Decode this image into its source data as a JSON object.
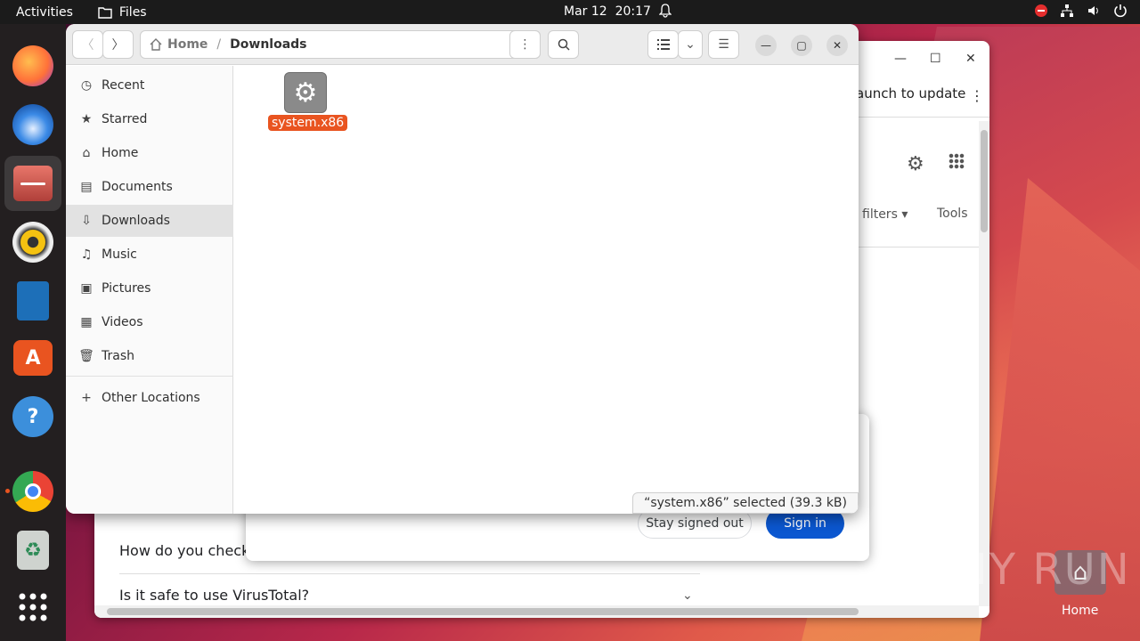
{
  "topbar": {
    "activities": "Activities",
    "app_name": "Files",
    "date": "Mar 12",
    "time": "20:17"
  },
  "browser": {
    "launch_text": "aunch to update",
    "filters_label": "filters",
    "tools_label": "Tools",
    "faq": [
      "How do you check i",
      "Is it safe to use VirusTotal?"
    ]
  },
  "signin": {
    "stay_out": "Stay signed out",
    "sign_in": "Sign in"
  },
  "files": {
    "breadcrumb_home": "Home",
    "breadcrumb_current": "Downloads",
    "sidebar": {
      "recent": "Recent",
      "starred": "Starred",
      "home": "Home",
      "documents": "Documents",
      "downloads": "Downloads",
      "music": "Music",
      "pictures": "Pictures",
      "videos": "Videos",
      "trash": "Trash",
      "other": "Other Locations"
    },
    "file_name": "system.x86",
    "status": "“system.x86” selected  (39.3 kB)"
  },
  "desktop": {
    "home_label": "Home",
    "watermark": "ANY RUN"
  }
}
